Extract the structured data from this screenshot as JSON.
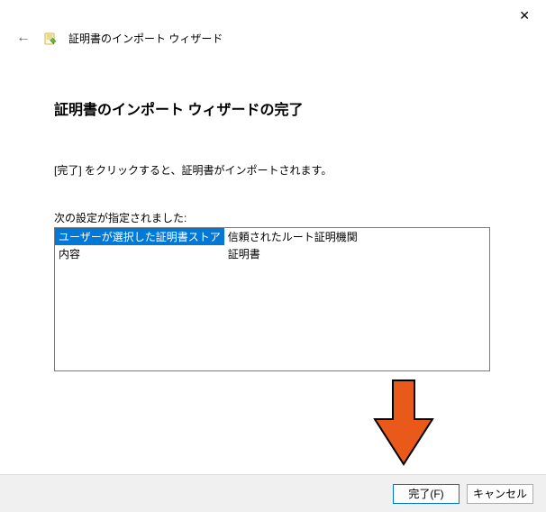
{
  "window": {
    "title": "証明書のインポート ウィザード"
  },
  "content": {
    "heading": "証明書のインポート ウィザードの完了",
    "instruction": "[完了] をクリックすると、証明書がインポートされます。",
    "settingsLabel": "次の設定が指定されました:",
    "settings": {
      "rows": [
        {
          "key": "ユーザーが選択した証明書ストア",
          "value": "信頼されたルート証明機関",
          "highlight": true
        },
        {
          "key": "内容",
          "value": "証明書",
          "highlight": false
        }
      ]
    }
  },
  "footer": {
    "finish": "完了(F)",
    "cancel": "キャンセル"
  },
  "annotation": {
    "arrowColor": "#e8591a",
    "arrowStroke": "#000"
  }
}
